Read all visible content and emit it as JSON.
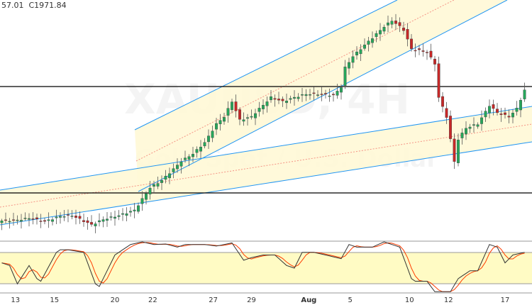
{
  "header": {
    "ohlc_prefix": "57.01",
    "close_label": "C1971.84"
  },
  "watermark": {
    "symbol": "XAUUSD, 4H",
    "name": "Gold Spot / U.S. Dollar"
  },
  "colors": {
    "up": "#26a65b",
    "down": "#c62828",
    "channel": "#2196f3",
    "midline": "#ef5350",
    "fill": "#fff8d6",
    "stoch_k": "#333333",
    "stoch_d": "#ff3d00",
    "stoch_band": "#fffbc4"
  },
  "chart_data": {
    "type": "candlestick",
    "price_levels": [
      1970,
      1800
    ],
    "price_scale": {
      "top_price": 2108,
      "bottom_price": 1755
    },
    "closes_keypoints": [
      [
        0,
        1775
      ],
      [
        4,
        1776
      ],
      [
        7,
        1779
      ],
      [
        11,
        1774
      ],
      [
        15,
        1782
      ],
      [
        18,
        1783
      ],
      [
        23,
        1769
      ],
      [
        26,
        1777
      ],
      [
        30,
        1783
      ],
      [
        34,
        1791
      ],
      [
        35,
        1799
      ],
      [
        38,
        1825
      ],
      [
        41,
        1836
      ],
      [
        44,
        1853
      ],
      [
        46,
        1865
      ],
      [
        49,
        1876
      ],
      [
        52,
        1893
      ],
      [
        55,
        1921
      ],
      [
        57,
        1932
      ],
      [
        59,
        1955
      ],
      [
        61,
        1927
      ],
      [
        64,
        1932
      ],
      [
        66,
        1944
      ],
      [
        69,
        1961
      ],
      [
        72,
        1955
      ],
      [
        75,
        1961
      ],
      [
        78,
        1966
      ],
      [
        82,
        1966
      ],
      [
        85,
        1964
      ],
      [
        87,
        1977
      ],
      [
        88,
        2006
      ],
      [
        90,
        2023
      ],
      [
        93,
        2040
      ],
      [
        95,
        2051
      ],
      [
        98,
        2068
      ],
      [
        100,
        2077
      ],
      [
        102,
        2068
      ],
      [
        103,
        2063
      ],
      [
        105,
        2034
      ],
      [
        107,
        2032
      ],
      [
        109,
        2029
      ],
      [
        111,
        2012
      ],
      [
        112,
        1961
      ],
      [
        114,
        1932
      ],
      [
        115,
        1898
      ],
      [
        116,
        1864
      ],
      [
        117,
        1898
      ],
      [
        119,
        1915
      ],
      [
        122,
        1921
      ],
      [
        125,
        1949
      ],
      [
        127,
        1938
      ],
      [
        130,
        1932
      ],
      [
        132,
        1944
      ],
      [
        134,
        1972
      ]
    ],
    "x_ticks": [
      {
        "label": "13",
        "bar": 3.5
      },
      {
        "label": "15",
        "bar": 13.5
      },
      {
        "label": "20",
        "bar": 29
      },
      {
        "label": "22",
        "bar": 38.7
      },
      {
        "label": "27",
        "bar": 54.2
      },
      {
        "label": "29",
        "bar": 64
      },
      {
        "label": "Aug",
        "bar": 78.7
      },
      {
        "label": "5",
        "bar": 89.3
      },
      {
        "label": "10",
        "bar": 104.5
      },
      {
        "label": "12",
        "bar": 114.5
      },
      {
        "label": "17",
        "bar": 129
      }
    ],
    "stochastic": {
      "levels": [
        80,
        20
      ],
      "k_keypoints": [
        [
          0,
          60
        ],
        [
          2,
          55
        ],
        [
          4,
          20
        ],
        [
          7,
          55
        ],
        [
          9,
          30
        ],
        [
          10,
          25
        ],
        [
          14,
          80
        ],
        [
          15,
          85
        ],
        [
          17,
          85
        ],
        [
          21,
          80
        ],
        [
          24,
          20
        ],
        [
          25,
          15
        ],
        [
          29,
          75
        ],
        [
          33,
          95
        ],
        [
          36,
          100
        ],
        [
          39,
          95
        ],
        [
          42,
          96
        ],
        [
          45,
          90
        ],
        [
          47,
          95
        ],
        [
          50,
          95
        ],
        [
          52,
          95
        ],
        [
          55,
          92
        ],
        [
          59,
          98
        ],
        [
          62,
          65
        ],
        [
          64,
          70
        ],
        [
          67,
          75
        ],
        [
          70,
          75
        ],
        [
          73,
          55
        ],
        [
          75,
          50
        ],
        [
          77,
          80
        ],
        [
          80,
          80
        ],
        [
          83,
          75
        ],
        [
          87,
          68
        ],
        [
          89,
          95
        ],
        [
          91,
          90
        ],
        [
          95,
          90
        ],
        [
          98,
          100
        ],
        [
          102,
          90
        ],
        [
          105,
          30
        ],
        [
          106,
          25
        ],
        [
          109,
          25
        ],
        [
          111,
          5
        ],
        [
          115,
          5
        ],
        [
          117,
          30
        ],
        [
          120,
          45
        ],
        [
          122,
          45
        ],
        [
          125,
          95
        ],
        [
          127,
          90
        ],
        [
          129,
          60
        ],
        [
          131,
          75
        ],
        [
          134,
          80
        ]
      ]
    }
  }
}
